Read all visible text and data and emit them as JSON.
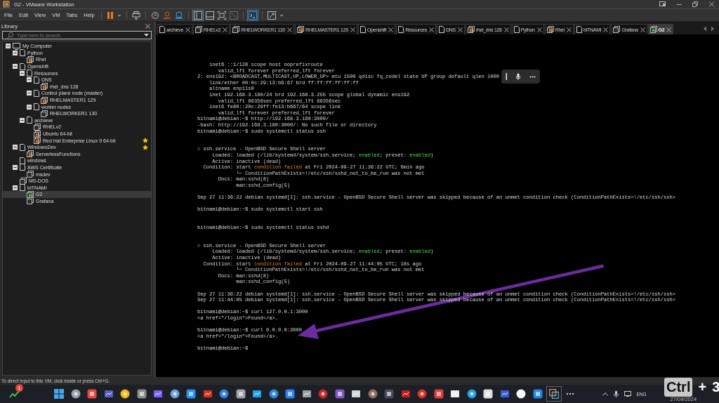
{
  "window": {
    "title": "G2 - VMware Workstation"
  },
  "menu": [
    "File",
    "Edit",
    "View",
    "VM",
    "Tabs",
    "Help"
  ],
  "library": {
    "title": "Library",
    "search": {
      "placeholder": "Type here to search"
    },
    "tree": [
      {
        "label": "My Computer",
        "kind": "computer",
        "expanded": true,
        "selected": false,
        "favorite": false,
        "children": [
          {
            "label": "Python",
            "kind": "folder",
            "expanded": true,
            "selected": false,
            "favorite": false,
            "children": [
              {
                "label": "Rhel",
                "kind": "paused",
                "selected": false,
                "favorite": false
              }
            ]
          },
          {
            "label": "Openshift",
            "kind": "folder",
            "expanded": true,
            "selected": false,
            "favorite": false,
            "children": [
              {
                "label": "Resources",
                "kind": "folder",
                "expanded": true,
                "selected": false,
                "favorite": false,
                "children": [
                  {
                    "label": "DNS",
                    "kind": "folder",
                    "expanded": true,
                    "selected": false,
                    "favorite": false,
                    "children": [
                      {
                        "label": "rhel_dns 128",
                        "kind": "paused",
                        "selected": false,
                        "favorite": false
                      }
                    ]
                  },
                  {
                    "label": "Control plane node (master)",
                    "kind": "folder",
                    "expanded": true,
                    "selected": false,
                    "favorite": false,
                    "children": [
                      {
                        "label": "RHELMASTER1 129",
                        "kind": "paused",
                        "selected": false,
                        "favorite": false
                      }
                    ]
                  },
                  {
                    "label": "worker nodes",
                    "kind": "folder",
                    "expanded": true,
                    "selected": false,
                    "favorite": false,
                    "children": [
                      {
                        "label": "RHELWORKER1 130",
                        "kind": "machine",
                        "selected": false,
                        "favorite": false
                      }
                    ]
                  }
                ]
              },
              {
                "label": "archieve",
                "kind": "folder",
                "expanded": true,
                "selected": false,
                "favorite": false,
                "children": [
                  {
                    "label": "RHELv2",
                    "kind": "machine",
                    "selected": false,
                    "favorite": false
                  },
                  {
                    "label": "Ubuntu 64-bit",
                    "kind": "paused",
                    "selected": false,
                    "favorite": false
                  },
                  {
                    "label": "Red Hat Enterprise Linux 9 64-bit",
                    "kind": "paused",
                    "selected": false,
                    "favorite": true
                  }
                ]
              }
            ]
          },
          {
            "label": "WindowsDev",
            "kind": "folder",
            "expanded": true,
            "selected": false,
            "favorite": true,
            "children": [
              {
                "label": "ServerlessFunctions",
                "kind": "paused",
                "selected": false,
                "favorite": false
              }
            ]
          },
          {
            "label": "windows",
            "kind": "folder",
            "selected": false,
            "favorite": false
          },
          {
            "label": "AWS Certificate",
            "kind": "folder",
            "expanded": true,
            "selected": false,
            "favorite": false,
            "children": [
              {
                "label": "msdev",
                "kind": "machine",
                "selected": false,
                "favorite": false
              }
            ]
          },
          {
            "label": "MS-DOS",
            "kind": "machine",
            "selected": false,
            "favorite": false
          },
          {
            "label": "bITNAMI",
            "kind": "folder",
            "expanded": true,
            "selected": false,
            "favorite": false,
            "children": [
              {
                "label": "G2",
                "kind": "running",
                "selected": true,
                "favorite": false
              },
              {
                "label": "Grafana",
                "kind": "machine",
                "selected": false,
                "favorite": false
              }
            ]
          }
        ]
      }
    ]
  },
  "tabs": [
    {
      "label": "archieve",
      "kind": "folder",
      "selected": false
    },
    {
      "label": "RHELv2",
      "kind": "machine",
      "selected": false
    },
    {
      "label": "RHELWORKER1 130",
      "kind": "machine",
      "selected": false
    },
    {
      "label": "RHELMASTER1 129",
      "kind": "paused",
      "selected": false
    },
    {
      "label": "Openshift",
      "kind": "folder",
      "selected": false
    },
    {
      "label": "Resources",
      "kind": "folder",
      "selected": false
    },
    {
      "label": "DNS",
      "kind": "folder",
      "selected": false
    },
    {
      "label": "rhel_dns 128",
      "kind": "paused",
      "selected": false
    },
    {
      "label": "Python",
      "kind": "folder",
      "selected": false
    },
    {
      "label": "Rhel",
      "kind": "paused",
      "selected": false
    },
    {
      "label": "bITNAMI",
      "kind": "folder",
      "selected": false
    },
    {
      "label": "Grafana",
      "kind": "machine",
      "selected": false
    },
    {
      "label": "G2",
      "kind": "running",
      "selected": true
    }
  ],
  "terminal": {
    "lines": [
      {
        "text": "    inet6 ::1/128 scope host noprefixroute"
      },
      {
        "text": "       valid_lft forever preferred_lft forever"
      },
      {
        "text": "2: ens192: <BROADCAST,MULTICAST,UP,LOWER_UP> mtu 1500 qdisc fq_codel state UP group default qlen 1000"
      },
      {
        "text": "    link/ether 00:0c:29:13:b6:67 brd ff:ff:ff:ff:ff:ff"
      },
      {
        "text": "    altname enp11s0"
      },
      {
        "text": "    inet 192.168.3.180/24 brd 192.168.3.255 scope global dynamic ens192"
      },
      {
        "text": "       valid_lft 86356sec preferred_lft 86356sec"
      },
      {
        "text": "    inet6 fe80::20c:29ff:fe13:b667/64 scope link"
      },
      {
        "text": "       valid_lft forever preferred_lft forever"
      },
      {
        "text": "bitnami@debian:~$ http://192.168.3.180:3000/"
      },
      {
        "text": "-bash: http://192.168.3.180:3000/: No such file or directory"
      },
      {
        "text": "bitnami@debian:~$ sudo systemctl status ssh"
      },
      {
        "kind": "blank"
      },
      {
        "kind": "blank"
      },
      {
        "text": "○ ssh.service - OpenBSD Secure Shell server"
      },
      {
        "segments": [
          {
            "text": "     Loaded: loaded (/lib/systemd/system/ssh.service; "
          },
          {
            "text": "enabled",
            "kind": "ok"
          },
          {
            "text": "; preset: "
          },
          {
            "text": "enabled",
            "kind": "ok"
          },
          {
            "text": ")"
          }
        ]
      },
      {
        "text": "     Active: inactive (dead)"
      },
      {
        "segments": [
          {
            "text": "  Condition: start "
          },
          {
            "text": "condition failed",
            "kind": "warn"
          },
          {
            "text": " at Fri 2024-09-27 11:36:22 UTC; 6min ago"
          }
        ]
      },
      {
        "text": "             └─ ConditionPathExists=!/etc/ssh/sshd_not_to_be_run was not met"
      },
      {
        "text": "       Docs: man:sshd(8)"
      },
      {
        "text": "             man:sshd_config(5)"
      },
      {
        "kind": "blank"
      },
      {
        "text": "Sep 27 11:36:22 debian systemd[1]: ssh.service - OpenBSD Secure Shell server was skipped because of an unmet condition check (ConditionPathExists=!/etc/ssh/ssh>"
      },
      {
        "kind": "blank"
      },
      {
        "text": "bitnami@debian:~$ sudo systemctl start ssh"
      },
      {
        "kind": "blank"
      },
      {
        "kind": "blank"
      },
      {
        "text": "bitnami@debian:~$ sudo systemctl status sshd"
      },
      {
        "kind": "blank"
      },
      {
        "kind": "blank"
      },
      {
        "text": "○ ssh.service - OpenBSD Secure Shell server"
      },
      {
        "segments": [
          {
            "text": "     Loaded: loaded (/lib/systemd/system/ssh.service; "
          },
          {
            "text": "enabled",
            "kind": "ok"
          },
          {
            "text": "; preset: "
          },
          {
            "text": "enabled",
            "kind": "ok"
          },
          {
            "text": ")"
          }
        ]
      },
      {
        "text": "     Active: inactive (dead)"
      },
      {
        "segments": [
          {
            "text": "  Condition: start "
          },
          {
            "text": "condition failed",
            "kind": "warn"
          },
          {
            "text": " at Fri 2024-09-27 11:44:05 UTC; 18s ago"
          }
        ]
      },
      {
        "text": "             └─ ConditionPathExists=!/etc/ssh/sshd_not_to_be_run was not met"
      },
      {
        "text": "       Docs: man:sshd(8)"
      },
      {
        "text": "             man:sshd_config(5)"
      },
      {
        "kind": "blank"
      },
      {
        "text": "Sep 27 11:36:22 debian systemd[1]: ssh.service - OpenBSD Secure Shell server was skipped because of an unmet condition check (ConditionPathExists=!/etc/ssh/ssh>"
      },
      {
        "text": "Sep 27 11:44:05 debian systemd[1]: ssh.service - OpenBSD Secure Shell server was skipped because of an unmet condition check (ConditionPathExists=!/etc/ssh/ssh>"
      },
      {
        "kind": "blank"
      },
      {
        "text": "bitnami@debian:~$ curl 127.0.0.1:3000"
      },
      {
        "text": "<a href=\"/login\">Found</a>."
      },
      {
        "kind": "blank"
      },
      {
        "text": "bitnami@debian:~$ curl 0.0.0.0:3000"
      },
      {
        "text": "<a href=\"/login\">Found</a>."
      },
      {
        "kind": "blank"
      },
      {
        "text": "bitnami@debian:~$"
      }
    ]
  },
  "status_bar": "To direct input to this VM, click inside or press Ctrl+G.",
  "taskbar": {
    "badge": "1",
    "language": "ENG",
    "date": "27/09/2024"
  },
  "key_overlay": {
    "keys": [
      "Ctrl",
      "+",
      "3"
    ]
  }
}
